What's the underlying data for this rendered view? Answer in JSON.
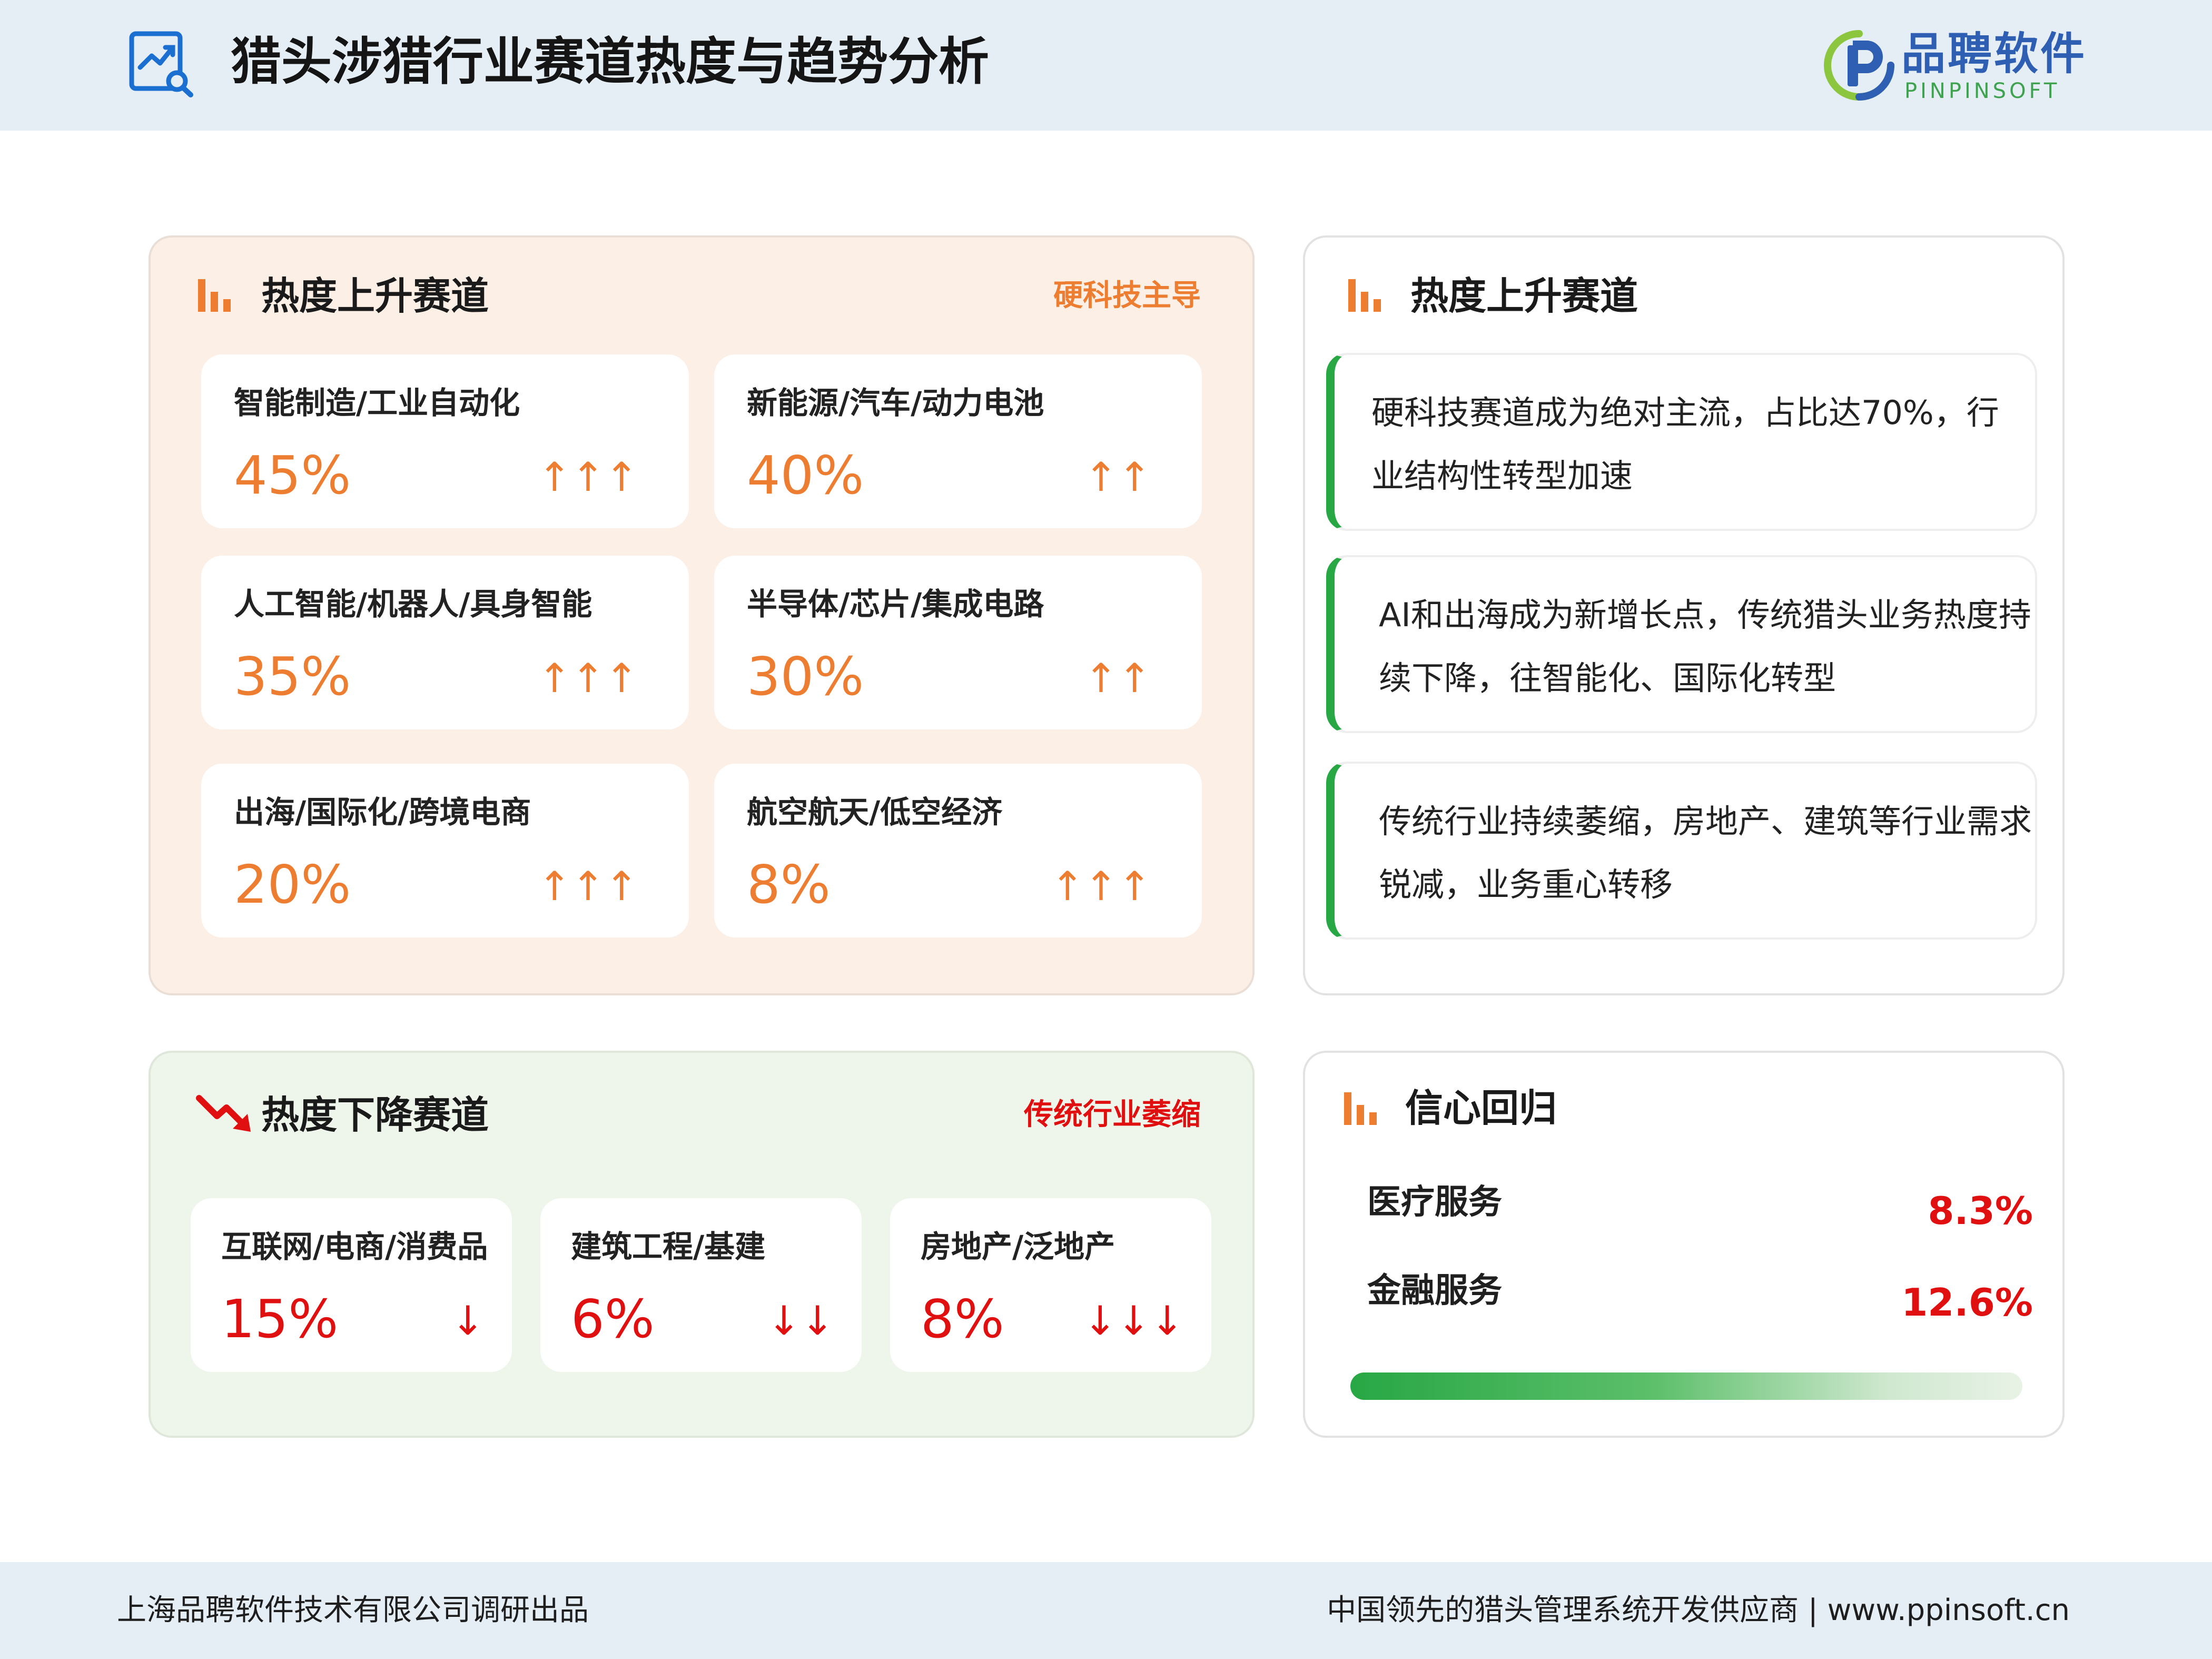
{
  "header": {
    "title": "猎头涉猎行业赛道热度与趋势分析",
    "brand_cn": "品聘软件",
    "brand_en": "PINPINSOFT"
  },
  "rising": {
    "title": "热度上升赛道",
    "tag": "硬科技主导",
    "cards": [
      {
        "name": "智能制造/工业自动化",
        "pct": "45%",
        "arrows": "↑↑↑"
      },
      {
        "name": "新能源/汽车/动力电池",
        "pct": "40%",
        "arrows": "↑↑"
      },
      {
        "name": "人工智能/机器人/具身智能",
        "pct": "35%",
        "arrows": "↑↑↑"
      },
      {
        "name": "半导体/芯片/集成电路",
        "pct": "30%",
        "arrows": "↑↑"
      },
      {
        "name": "出海/国际化/跨境电商",
        "pct": "20%",
        "arrows": "↑↑↑"
      },
      {
        "name": "航空航天/低空经济",
        "pct": "8%",
        "arrows": "↑↑↑"
      }
    ]
  },
  "insights": {
    "title": "热度上升赛道",
    "items": [
      {
        "text": "硬科技赛道成为绝对主流，占比达70%，行业结构性转型加速"
      },
      {
        "text": "AI和出海成为新增长点，传统猎头业务热度持续下降，往智能化、国际化转型"
      },
      {
        "text": "传统行业持续萎缩，房地产、建筑等行业需求锐减，业务重心转移"
      }
    ]
  },
  "falling": {
    "title": "热度下降赛道",
    "tag": "传统行业萎缩",
    "cards": [
      {
        "name": "互联网/电商/消费品",
        "pct": "15%",
        "arrows": "↓"
      },
      {
        "name": "建筑工程/基建",
        "pct": "6%",
        "arrows": "↓↓"
      },
      {
        "name": "房地产/泛地产",
        "pct": "8%",
        "arrows": "↓↓↓"
      }
    ]
  },
  "confidence": {
    "title": "信心回归",
    "rows": [
      {
        "label": "医疗服务",
        "value": "8.3%"
      },
      {
        "label": "金融服务",
        "value": "12.6%"
      }
    ]
  },
  "footer": {
    "left": "上海品聘软件技术有限公司调研出品",
    "right": "中国领先的猎头管理系统开发供应商 |  www.ppinsoft.cn"
  },
  "colors": {
    "accent_orange": "#ed7d31",
    "accent_red": "#e01010",
    "accent_green": "#28a745",
    "brand_blue": "#2f5fb3"
  }
}
